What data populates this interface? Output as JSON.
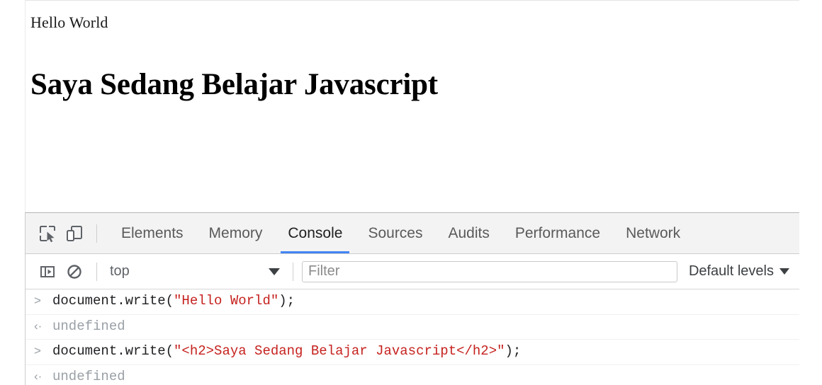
{
  "page": {
    "body_text": "Hello World",
    "heading_text": "Saya Sedang Belajar Javascript"
  },
  "devtools": {
    "icons": {
      "inspect": "inspect-element-icon",
      "device": "device-toolbar-icon",
      "sidebar": "console-sidebar-toggle-icon",
      "clear": "clear-console-icon"
    },
    "tabs": [
      {
        "label": "Elements",
        "active": false
      },
      {
        "label": "Memory",
        "active": false
      },
      {
        "label": "Console",
        "active": true
      },
      {
        "label": "Sources",
        "active": false
      },
      {
        "label": "Audits",
        "active": false
      },
      {
        "label": "Performance",
        "active": false
      },
      {
        "label": "Network",
        "active": false
      }
    ],
    "toolbar": {
      "context_value": "top",
      "filter_value": "",
      "filter_placeholder": "Filter",
      "levels_label": "Default levels"
    },
    "console_rows": [
      {
        "kind": "input",
        "arrow": ">",
        "prefix": "document.write(",
        "string": "\"Hello World\"",
        "suffix": ");"
      },
      {
        "kind": "output",
        "arrow": "‹·",
        "text": "undefined"
      },
      {
        "kind": "input",
        "arrow": ">",
        "prefix": "document.write(",
        "string": "\"<h2>Saya Sedang Belajar Javascript</h2>\"",
        "suffix": ");"
      },
      {
        "kind": "output",
        "arrow": "‹·",
        "text": "undefined"
      }
    ]
  },
  "colors": {
    "accent_blue": "#4285f4",
    "string_red": "#c5221f",
    "muted_grey": "#9aa0a6",
    "tabbar_bg": "#f3f3f3"
  }
}
